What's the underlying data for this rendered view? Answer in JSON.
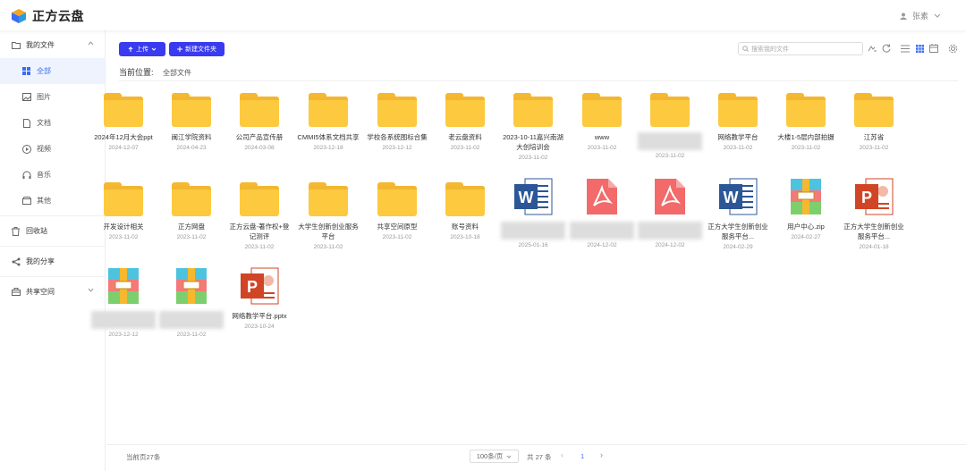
{
  "app": {
    "name": "正方云盘",
    "user": "张素"
  },
  "sidebar": {
    "items": [
      {
        "label": "我的文件",
        "icon": "folder-icon"
      },
      {
        "label": "全部",
        "icon": "grid-icon"
      },
      {
        "label": "图片",
        "icon": "image-icon"
      },
      {
        "label": "文档",
        "icon": "doc-icon"
      },
      {
        "label": "视频",
        "icon": "video-icon"
      },
      {
        "label": "音乐",
        "icon": "headphones-icon"
      },
      {
        "label": "其他",
        "icon": "other-icon"
      },
      {
        "label": "回收站",
        "icon": "trash-icon"
      },
      {
        "label": "我的分享",
        "icon": "share-icon"
      },
      {
        "label": "共享空间",
        "icon": "shared-space-icon"
      }
    ]
  },
  "toolbar": {
    "upload": "上传",
    "new_folder": "新建文件夹",
    "search_placeholder": "搜索我的文件"
  },
  "breadcrumb": {
    "label": "当前位置:",
    "value": "全部文件"
  },
  "files": [
    {
      "name": "2024年12月大会ppt",
      "date": "2024-12-07",
      "type": "folder"
    },
    {
      "name": "闽江学院资料",
      "date": "2024-04-23",
      "type": "folder"
    },
    {
      "name": "公司产品宣传册",
      "date": "2024-03-08",
      "type": "folder"
    },
    {
      "name": "CMMI5体系文档共享",
      "date": "2023-12-18",
      "type": "folder"
    },
    {
      "name": "学校各系统图标合集",
      "date": "2023-12-12",
      "type": "folder"
    },
    {
      "name": "老云盘资料",
      "date": "2023-11-02",
      "type": "folder"
    },
    {
      "name": "2023-10-11嘉兴南湖大创培训会",
      "date": "2023-11-02",
      "type": "folder"
    },
    {
      "name": "www",
      "date": "2023-11-02",
      "type": "folder"
    },
    {
      "name": "",
      "date": "2023-11-02",
      "type": "folder",
      "blur": true
    },
    {
      "name": "网络教学平台",
      "date": "2023-11-02",
      "type": "folder"
    },
    {
      "name": "大楼1-5层内部拍摄",
      "date": "2023-11-02",
      "type": "folder"
    },
    {
      "name": "江苏省",
      "date": "2023-11-02",
      "type": "folder"
    },
    {
      "name": "开发设计相关",
      "date": "2023-11-02",
      "type": "folder"
    },
    {
      "name": "正方网盘",
      "date": "2023-11-02",
      "type": "folder"
    },
    {
      "name": "正方云盘-著作权+登记测评",
      "date": "2023-11-02",
      "type": "folder"
    },
    {
      "name": "大学生创新创业服务平台",
      "date": "2023-11-02",
      "type": "folder"
    },
    {
      "name": "共享空间原型",
      "date": "2023-11-02",
      "type": "folder"
    },
    {
      "name": "账号资料",
      "date": "2023-10-18",
      "type": "folder"
    },
    {
      "name": "",
      "date": "2025-01-16",
      "type": "word",
      "blur": true
    },
    {
      "name": "",
      "date": "2024-12-02",
      "type": "pdf",
      "blur": true
    },
    {
      "name": "",
      "date": "2024-12-02",
      "type": "pdf",
      "blur": true
    },
    {
      "name": "正方大学生创新创业服务平台...",
      "date": "2024-02-29",
      "type": "word"
    },
    {
      "name": "用户中心.zip",
      "date": "2024-02-27",
      "type": "zip"
    },
    {
      "name": "正方大学生创新创业服务平台...",
      "date": "2024-01-18",
      "type": "ppt"
    },
    {
      "name": "",
      "date": "2023-12-12",
      "type": "zip",
      "blur": true
    },
    {
      "name": "",
      "date": "2023-11-02",
      "type": "zip",
      "blur": true
    },
    {
      "name": "网络教学平台.pptx",
      "date": "2023-10-24",
      "type": "ppt"
    }
  ],
  "footer": {
    "current_page": "当前页27条",
    "page_size": "100条/页",
    "total": "共 27 条",
    "page": "1"
  },
  "colors": {
    "accent": "#3a3af0",
    "folder": "#fcc93f",
    "word": "#2b5797",
    "pdf": "#f26a6a",
    "ppt": "#d04525"
  }
}
